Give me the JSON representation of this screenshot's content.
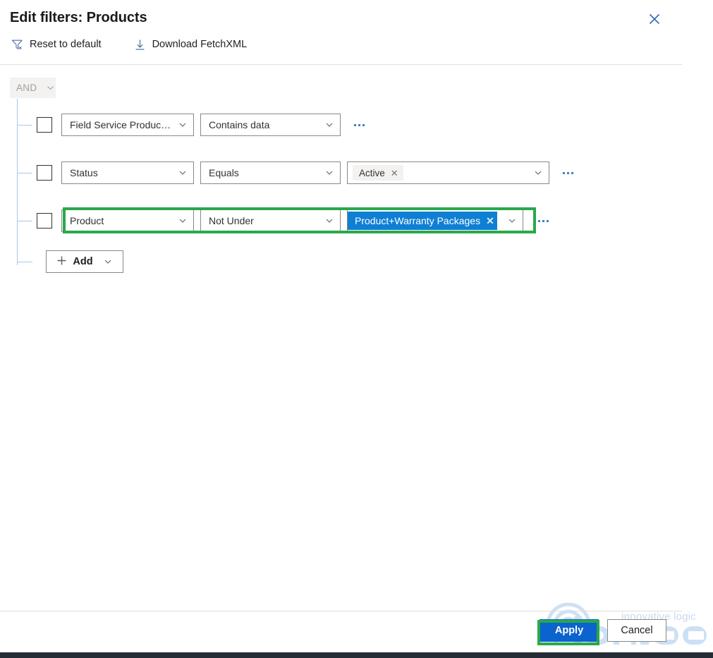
{
  "header": {
    "title": "Edit filters: Products",
    "close_icon": "close-icon"
  },
  "commandbar": {
    "reset": {
      "label": "Reset to default",
      "icon": "filter-clear-icon"
    },
    "download": {
      "label": "Download FetchXML",
      "icon": "download-arrow-icon"
    }
  },
  "filters": {
    "group_operator": "AND",
    "group_chevron_icon": "chevron-down-icon",
    "rows": [
      {
        "field": "Field Service Product Ty...",
        "operator": "Contains data",
        "value": null,
        "value_kind": "none",
        "highlighted": false,
        "overflow_icon": "more-options-icon"
      },
      {
        "field": "Status",
        "operator": "Equals",
        "value": "Active",
        "value_kind": "gray-pill",
        "value_remove_icon": "remove-tag-icon",
        "highlighted": false,
        "overflow_icon": "more-options-icon"
      },
      {
        "field": "Product",
        "operator": "Not Under",
        "value": "Product+Warranty Packages",
        "value_kind": "blue-pill",
        "value_remove_icon": "remove-tag-icon",
        "highlighted": true,
        "overflow_icon": "more-options-icon"
      }
    ],
    "add": {
      "label": "Add",
      "plus_icon": "plus-icon",
      "chevron_icon": "chevron-down-icon"
    }
  },
  "footer": {
    "apply_label": "Apply",
    "cancel_label": "Cancel"
  },
  "watermark": {
    "text": "innovative logic",
    "logo": "inogic-logo"
  },
  "colors": {
    "accent_blue": "#0b63ce",
    "tag_blue": "#0f7fd4",
    "highlight_green": "#2aa84a",
    "tree_line": "#a9c7e8",
    "border_gray": "#8a8886",
    "watermark_blue": "#c8d9ee",
    "bottom_strip": "#242c35"
  }
}
